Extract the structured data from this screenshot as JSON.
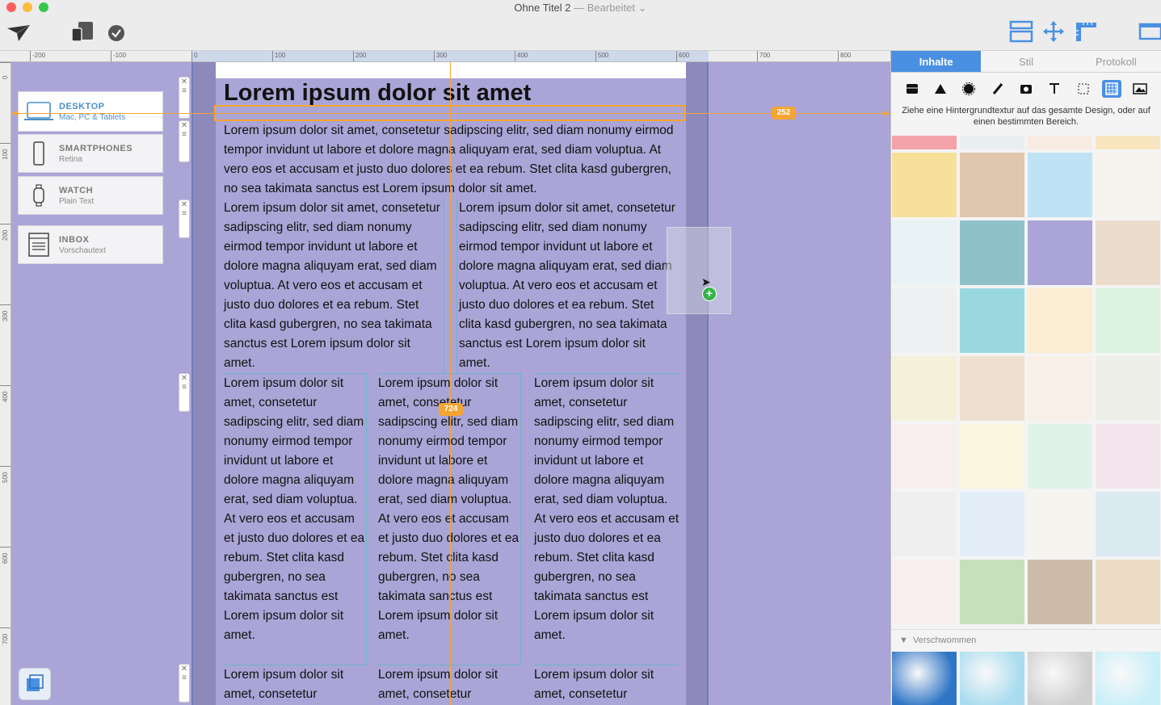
{
  "window": {
    "title": "Ohne Titel 2",
    "title_sep": " — ",
    "status": "Bearbeitet",
    "status_chevron": "⌄"
  },
  "toolbar": {
    "left_icons": [
      "paper-plane-icon",
      "devices-icon",
      "checkmark-icon"
    ],
    "right_icons": [
      "layout-icon",
      "move-arrows-icon",
      "ruler-icon",
      "sidebar-icon"
    ]
  },
  "ruler": {
    "h_labels": [
      "-200",
      "-100",
      "0",
      "100",
      "200",
      "300",
      "400",
      "500",
      "600",
      "700",
      "800"
    ],
    "v_labels": [
      "0",
      "100",
      "200",
      "300",
      "400",
      "500",
      "600",
      "700"
    ]
  },
  "devices": [
    {
      "name": "DESKTOP",
      "desc": "Mac, PC & Tablets",
      "icon": "laptop-icon",
      "active": true
    },
    {
      "name": "SMARTPHONES",
      "desc": "Retina",
      "icon": "smartphone-icon",
      "active": false
    },
    {
      "name": "WATCH",
      "desc": "Plain Text",
      "icon": "watch-icon",
      "active": false
    },
    {
      "name": "INBOX",
      "desc": "Vorschautext",
      "icon": "inbox-icon",
      "active": false
    }
  ],
  "guides": {
    "width_badge": "252",
    "height_badge": "724"
  },
  "content": {
    "heading": "Lorem ipsum dolor sit amet",
    "para_full": "Lorem ipsum dolor sit amet, consetetur sadipscing elitr, sed diam nonumy eirmod tempor invidunt ut labore et dolore magna aliquyam erat, sed diam voluptua. At vero eos et accusam et justo duo dolores et ea rebum. Stet clita kasd gubergren, no sea takimata sanctus est Lorem ipsum dolor sit amet.",
    "two_col": [
      "Lorem ipsum dolor sit amet, consetetur sadipscing elitr, sed diam nonumy eirmod tempor invidunt ut labore et dolore magna aliquyam erat, sed diam voluptua. At vero eos et accusam et justo duo dolores et ea rebum. Stet clita kasd gubergren, no sea takimata sanctus est Lorem ipsum dolor sit amet.",
      "Lorem ipsum dolor sit amet, consetetur sadipscing elitr, sed diam nonumy eirmod tempor invidunt ut labore et dolore magna aliquyam erat, sed diam voluptua. At vero eos et accusam et justo duo dolores et ea rebum. Stet clita kasd gubergren, no sea takimata sanctus est Lorem ipsum dolor sit amet."
    ],
    "three_col": [
      "Lorem ipsum dolor sit amet, consetetur sadipscing elitr, sed diam nonumy eirmod tempor invidunt ut labore et dolore magna aliquyam erat, sed diam voluptua. At vero eos et accusam et justo duo dolores et ea rebum. Stet clita kasd gubergren, no sea takimata sanctus est Lorem ipsum dolor sit amet.",
      "Lorem ipsum dolor sit amet, consetetur sadipscing elitr, sed diam nonumy eirmod tempor invidunt ut labore et dolore magna aliquyam erat, sed diam voluptua. At vero eos et accusam et justo duo dolores et ea rebum. Stet clita kasd gubergren, no sea takimata sanctus est Lorem ipsum dolor sit amet.",
      "Lorem ipsum dolor sit amet, consetetur sadipscing elitr, sed diam nonumy eirmod tempor invidunt ut labore et dolore magna aliquyam erat, sed diam voluptua. At vero eos et accusam et justo duo dolores et ea rebum. Stet clita kasd gubergren, no sea takimata sanctus est Lorem ipsum dolor sit amet."
    ],
    "three_col_next": [
      "Lorem ipsum dolor sit amet, consetetur",
      "Lorem ipsum dolor sit amet, consetetur",
      "Lorem ipsum dolor sit amet, consetetur"
    ]
  },
  "panel": {
    "tabs": [
      "Inhalte",
      "Stil",
      "Protokoll"
    ],
    "active_tab": "Inhalte",
    "tools": [
      "layout-icon",
      "shape-icon",
      "badge-icon",
      "brush-icon",
      "media-icon",
      "text-icon",
      "selection-icon",
      "texture-icon",
      "image-icon"
    ],
    "hint": "Ziehe eine Hintergrundtextur auf das gesamte Design, oder auf einen bestimmten Bereich.",
    "swatches": [
      "#f4a3a8",
      "#e9eef0",
      "#f8ebe2",
      "#f7e6c0",
      "#f7e19a",
      "#dfc6ae",
      "#bfe3f4",
      "#f6f3ec",
      "#e9f3f6",
      "#8fc2c8",
      "#aaa5d6",
      "#ecdccb",
      "#eef0f1",
      "#9ad8df",
      "#fbedd2",
      "#dcf3df",
      "#f5f0d9",
      "#eddfcf",
      "#f8efe8",
      "#eeeee9",
      "#f8eeee",
      "#faf6e0",
      "#dff3ea",
      "#f3e4ec",
      "#efefef",
      "#e2edf8",
      "#f6f4ee",
      "#dcebf2",
      "#f9eeee",
      "#c6e0bc",
      "#cdbba9",
      "#ecdcc6"
    ],
    "section_label": "Verschwommen",
    "blur_colors": [
      "#2f75c6",
      "#a9dcef",
      "#d0d0d0",
      "#c9eff8"
    ]
  }
}
